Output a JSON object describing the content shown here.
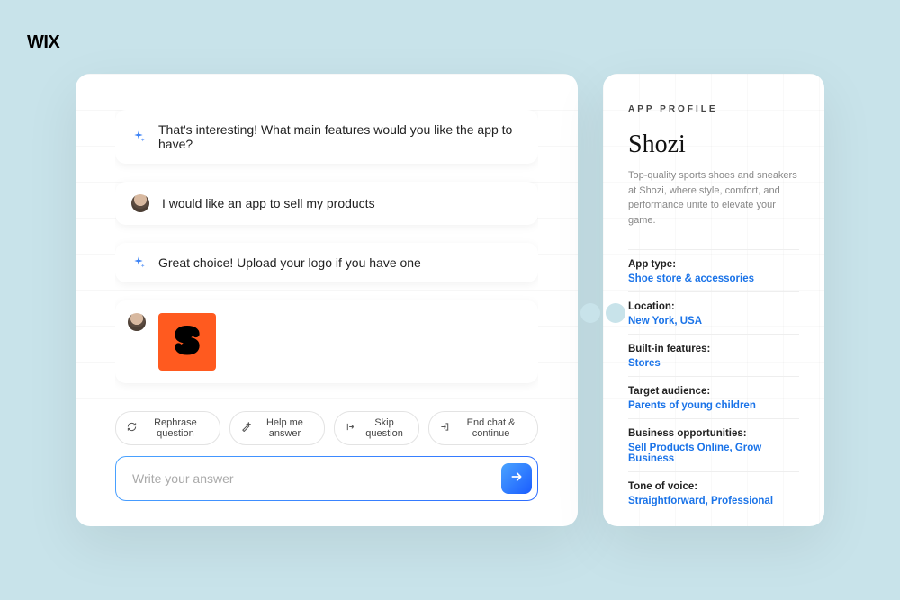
{
  "brand": "WIX",
  "chat": {
    "messages": [
      {
        "role": "ai",
        "text": "That's interesting! What main features would you like the app to have?"
      },
      {
        "role": "user",
        "text": "I would like an app to sell my products"
      },
      {
        "role": "ai",
        "text": "Great choice!  Upload your logo if you have one"
      },
      {
        "role": "user-image",
        "alt": "Shozi orange S logo"
      }
    ],
    "toolbar": {
      "rephrase": "Rephrase question",
      "help": "Help me answer",
      "skip": "Skip question",
      "end": "End chat & continue"
    },
    "input_placeholder": "Write your answer"
  },
  "profile": {
    "label": "APP PROFILE",
    "title": "Shozi",
    "description": "Top-quality sports shoes and sneakers at Shozi, where style, comfort, and performance unite to elevate your game.",
    "fields": [
      {
        "label": "App type:",
        "value": "Shoe store & accessories"
      },
      {
        "label": "Location:",
        "value": "New York, USA"
      },
      {
        "label": "Built-in features:",
        "value": "Stores"
      },
      {
        "label": "Target audience:",
        "value": "Parents of young children"
      },
      {
        "label": "Business opportunities:",
        "value": "Sell Products Online, Grow Business"
      },
      {
        "label": "Tone of voice:",
        "value": "Straightforward, Professional"
      }
    ]
  }
}
